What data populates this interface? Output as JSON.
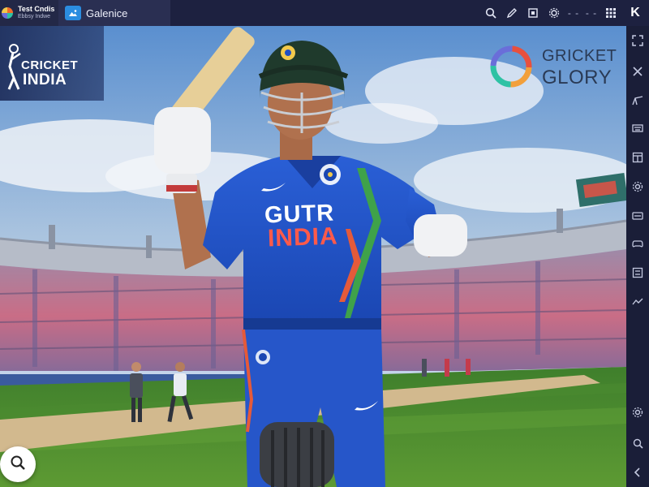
{
  "tabs": [
    {
      "title": "Test Cndis",
      "subtitle": "Ebbsy Indwe",
      "icon": "cricket-logo-icon"
    },
    {
      "title": "Galenice",
      "icon": "gallery-app-icon"
    }
  ],
  "toolbar": {
    "icons": [
      "search-icon",
      "pen-icon",
      "frame-icon",
      "settings-icon",
      "more-dashes-icon",
      "more-dashes-icon",
      "grid-icon"
    ],
    "dash_label": "- -",
    "last_label": "K"
  },
  "sidebar": {
    "icons": [
      "expand-icon",
      "close-icon",
      "edit-icon",
      "keyboard-icon",
      "window-icon",
      "gear-icon",
      "keyboard-alt-icon",
      "gamepad-icon",
      "keymap-icon",
      "gesture-icon",
      "gear-small-icon",
      "search-icon",
      "back-icon"
    ]
  },
  "scene": {
    "logo_left": {
      "line1": "CRICKET",
      "line2": "INDIA"
    },
    "logo_right": {
      "line1": "GRICKET",
      "line2": "GLORY"
    },
    "jersey": {
      "line1": "GUTR",
      "line2": "INDIA"
    }
  },
  "colors": {
    "sky_top": "#4a82c4",
    "sky_bottom": "#dbe4ef",
    "jersey_blue": "#1f4fc4",
    "pitch_green": "#4f8a2e",
    "window_chrome": "#1d2140",
    "accent": "#2b8de0"
  }
}
